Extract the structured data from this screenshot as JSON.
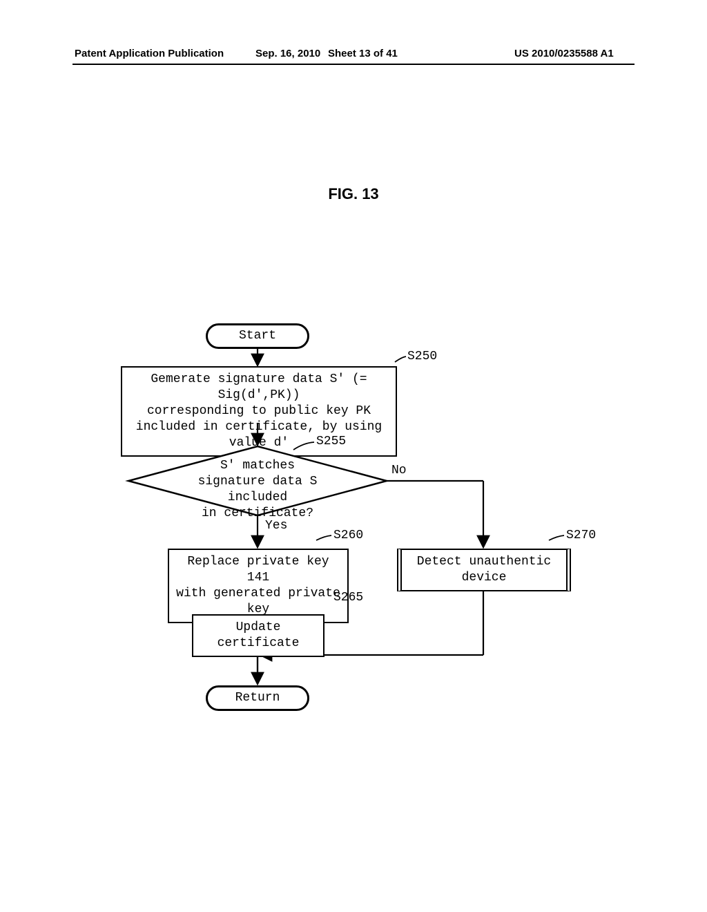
{
  "header": {
    "publication_type": "Patent Application Publication",
    "date": "Sep. 16, 2010",
    "sheet": "Sheet 13 of 41",
    "publication_number": "US 2010/0235588 A1"
  },
  "figure": {
    "title": "FIG. 13"
  },
  "flowchart": {
    "start": "Start",
    "return": "Return",
    "s250": {
      "label": "S250",
      "text_l1": "Gemerate signature data S' (= Sig(d',PK))",
      "text_l2": "corresponding to public key PK",
      "text_l3": "included in certificate, by using value d'"
    },
    "s255": {
      "label": "S255",
      "text_l1": "S' matches",
      "text_l2": "signature data S included",
      "text_l3": "in certificate?",
      "yes": "Yes",
      "no": "No"
    },
    "s260": {
      "label": "S260",
      "text_l1": "Replace private key 141",
      "text_l2": "with generated private key"
    },
    "s265": {
      "label": "S265",
      "text": "Update certificate"
    },
    "s270": {
      "label": "S270",
      "text": "Detect unauthentic device"
    }
  }
}
